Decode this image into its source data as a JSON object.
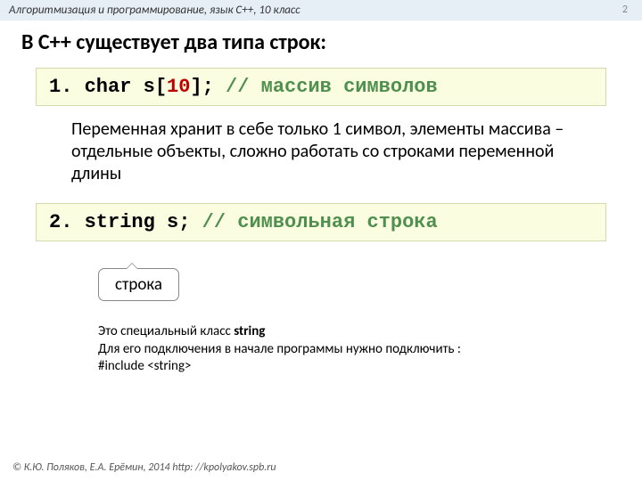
{
  "header": {
    "text": "Алгоритмизация и программирование, язык C++, 10 класс",
    "page": "2"
  },
  "title": "В C++ существует два типа строк:",
  "code1": {
    "lead": "1. ",
    "kw": "char ",
    "id": "s",
    "br1": "[",
    "num": "10",
    "br2": "];",
    "gap": "  ",
    "comment": "// массив символов"
  },
  "para1": "Переменная хранит в себе только 1 символ, элементы массива – отдельные объекты, сложно работать со строками переменной длины",
  "code2": {
    "lead": "2. ",
    "kw": "string ",
    "id": "s;",
    "gap": "   ",
    "comment": "// символьная строка"
  },
  "callout": "строка",
  "note": {
    "l1a": "Это специальный класс ",
    "l1b": "string",
    "l2": "Для его подключения в начале программы нужно подключить :",
    "l3": "#include <string>"
  },
  "footer": "© К.Ю. Поляков, Е.А. Ерёмин, 2014   http: //kpolyakov.spb.ru"
}
